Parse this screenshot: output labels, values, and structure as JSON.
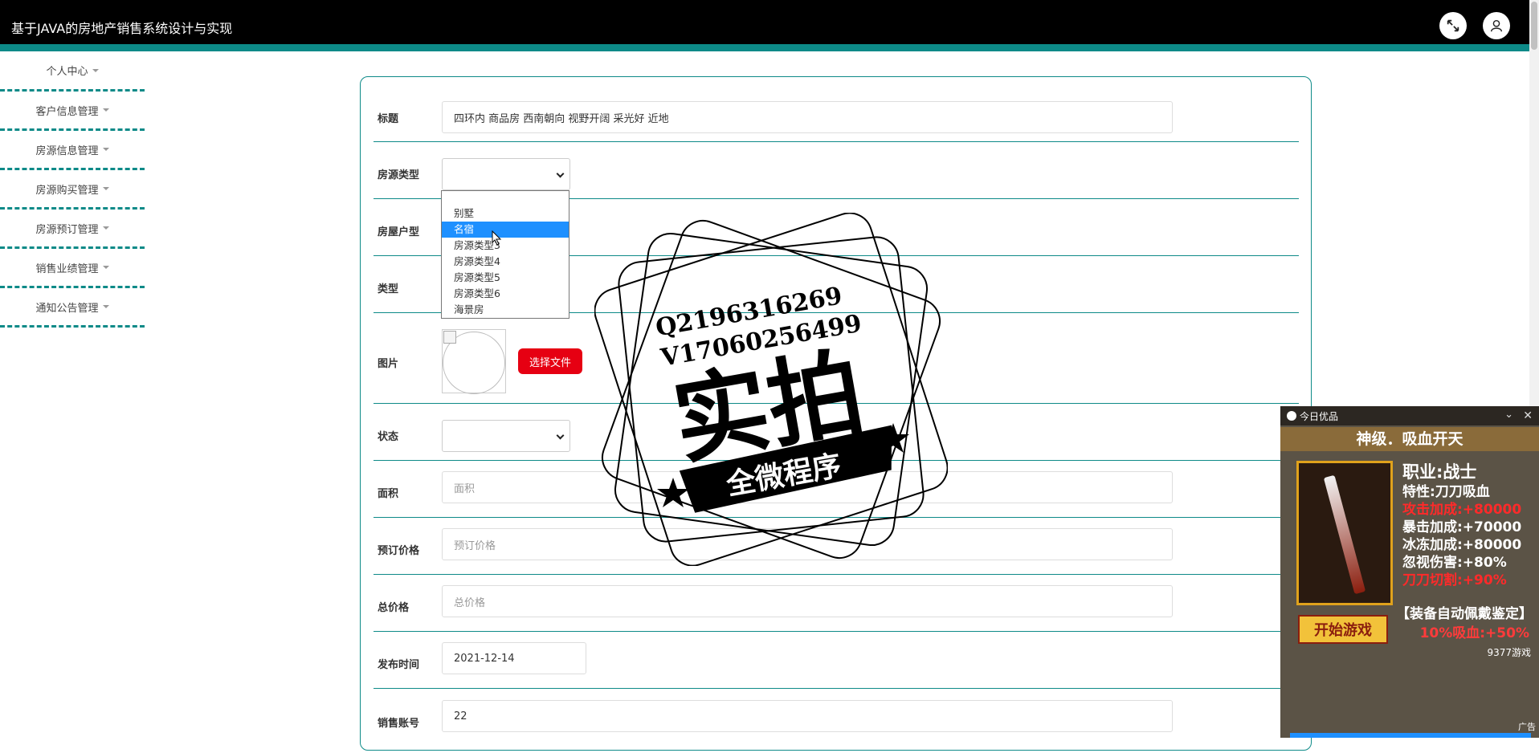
{
  "header": {
    "title": "基于JAVA的房地产销售系统设计与实现",
    "fullscreen_icon": "expand-icon",
    "user_icon": "user-icon"
  },
  "sidebar": {
    "items": [
      {
        "label": "个人中心"
      },
      {
        "label": "客户信息管理"
      },
      {
        "label": "房源信息管理"
      },
      {
        "label": "房源购买管理"
      },
      {
        "label": "房源预订管理"
      },
      {
        "label": "销售业绩管理"
      },
      {
        "label": "通知公告管理"
      }
    ]
  },
  "form": {
    "title": {
      "label": "标题",
      "value": "四环内 商品房 西南朝向 视野开阔 采光好 近地"
    },
    "house_type": {
      "label": "房源类型",
      "value": ""
    },
    "layout": {
      "label": "房屋户型"
    },
    "category": {
      "label": "类型"
    },
    "image": {
      "label": "图片",
      "button": "选择文件"
    },
    "status": {
      "label": "状态",
      "value": ""
    },
    "area": {
      "label": "面积",
      "placeholder": "面积"
    },
    "deposit": {
      "label": "预订价格",
      "placeholder": "预订价格"
    },
    "total_price": {
      "label": "总价格",
      "placeholder": "总价格"
    },
    "publish_time": {
      "label": "发布时间",
      "value": "2021-12-14"
    },
    "sales_account": {
      "label": "销售账号",
      "value": "22"
    }
  },
  "dropdown": {
    "options": [
      "别墅",
      "名宿",
      "房源类型3",
      "房源类型4",
      "房源类型5",
      "房源类型6",
      "海景房"
    ],
    "selected": "名宿"
  },
  "watermark": {
    "qq": "Q2196316269",
    "wechat": "V17060256499",
    "big_text": "实拍",
    "ribbon": "全微程序"
  },
  "ad": {
    "source": "今日优品",
    "headline": "神级．吸血开天",
    "stats": [
      {
        "text": "职业:战士",
        "color": "white",
        "big": true
      },
      {
        "text": "特性:刀刀吸血",
        "color": "white"
      },
      {
        "text": "攻击加成:+80000",
        "color": "red"
      },
      {
        "text": "暴击加成:+70000",
        "color": "white"
      },
      {
        "text": "冰冻加成:+80000",
        "color": "white"
      },
      {
        "text": "忽视伤害:+80%",
        "color": "white"
      },
      {
        "text": "刀刀切割:+90%",
        "color": "red"
      }
    ],
    "banner": "【装备自动佩戴鉴定】",
    "banner2": "10%吸血:+50%",
    "play_button": "开始游戏",
    "brand": "9377游戏",
    "tag": "广告"
  }
}
